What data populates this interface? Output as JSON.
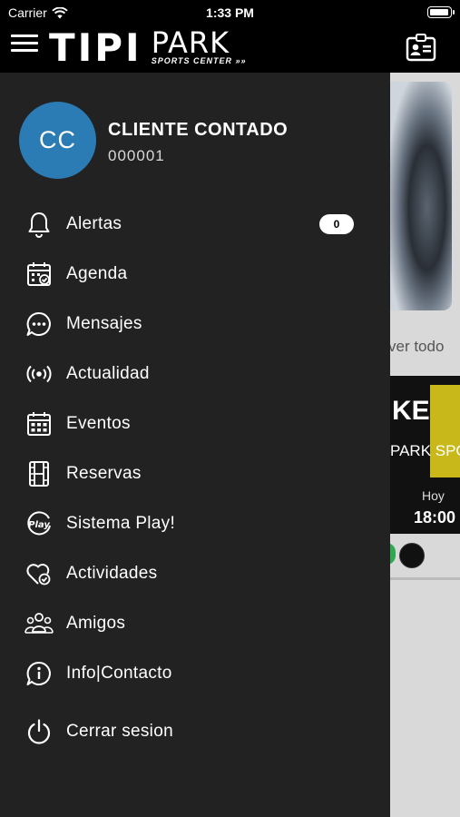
{
  "status_bar": {
    "carrier": "Carrier",
    "time": "1:33 PM",
    "battery_level": 1.0
  },
  "header": {
    "logo_main": "TIPI",
    "logo_park": "PARK",
    "logo_sub": "SPORTS CENTER »»"
  },
  "profile": {
    "initials": "CC",
    "name": "CLIENTE CONTADO",
    "id": "000001",
    "avatar_color": "#2b7bb4"
  },
  "menu": {
    "items": [
      {
        "label": "Alertas",
        "icon": "bell-icon",
        "badge": "0"
      },
      {
        "label": "Agenda",
        "icon": "calendar-check-icon"
      },
      {
        "label": "Mensajes",
        "icon": "chat-icon"
      },
      {
        "label": "Actualidad",
        "icon": "broadcast-icon"
      },
      {
        "label": "Eventos",
        "icon": "calendar-grid-icon"
      },
      {
        "label": "Reservas",
        "icon": "film-icon"
      },
      {
        "label": "Sistema Play!",
        "icon": "play-logo-icon"
      },
      {
        "label": "Actividades",
        "icon": "heart-check-icon"
      },
      {
        "label": "Amigos",
        "icon": "friends-icon"
      },
      {
        "label": "Info|Contacto",
        "icon": "info-icon"
      },
      {
        "label": "Cerrar sesion",
        "icon": "power-icon"
      }
    ]
  },
  "background": {
    "see_all": "ver todo",
    "banner_text": "KE",
    "banner_sub": "PARK SPO",
    "day": "Hoy",
    "time": "18:00"
  },
  "colors": {
    "drawer_bg": "#222222",
    "accent_green": "#2fa84f"
  }
}
